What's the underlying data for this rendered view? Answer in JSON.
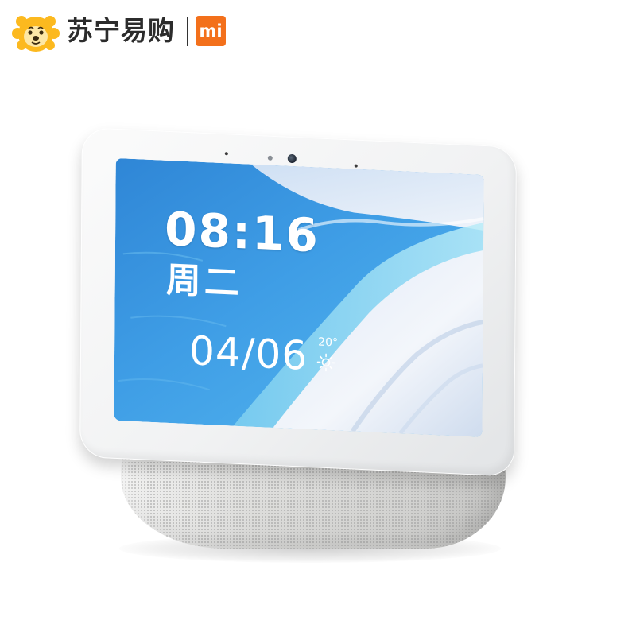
{
  "header": {
    "store_name": "苏宁易购",
    "brand_logo_text": "mi",
    "store_color": "#fcb91f",
    "brand_color": "#f3701b"
  },
  "screen": {
    "time": "08:16",
    "weekday": "周二",
    "date": "04/06",
    "temperature": "20°",
    "weather_icon": "sun-icon"
  }
}
